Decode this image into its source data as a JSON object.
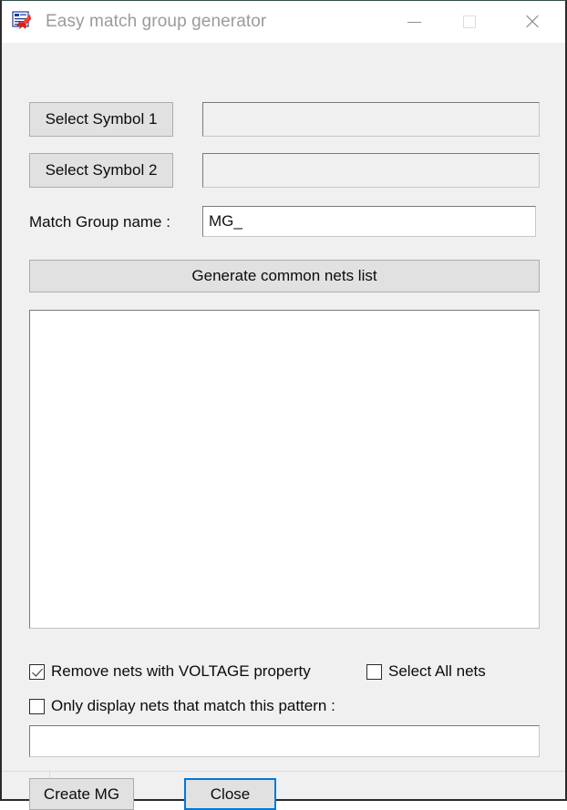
{
  "window": {
    "title": "Easy match group generator",
    "icon": "app-document-rocket-icon",
    "controls": {
      "minimize": "minimize-icon",
      "maximize": "maximize-icon",
      "close": "close-icon"
    },
    "title_color": "#9b9b9b",
    "accent_color": "#0078d7"
  },
  "form": {
    "select_symbol_1_label": "Select Symbol 1",
    "symbol_1_value": "",
    "symbol_1_placeholder": "",
    "select_symbol_2_label": "Select Symbol 2",
    "symbol_2_value": "",
    "symbol_2_placeholder": "",
    "match_group_name_label": "Match Group name :",
    "match_group_name_value": "MG_",
    "match_group_name_placeholder": "",
    "generate_label": "Generate common nets list",
    "nets_list_items": []
  },
  "options": {
    "remove_voltage_label": "Remove nets with VOLTAGE property",
    "remove_voltage_checked": true,
    "select_all_label": "Select All nets",
    "select_all_checked": false,
    "pattern_label": "Only display nets that match this pattern :",
    "pattern_checked": false,
    "pattern_value": "",
    "pattern_placeholder": ""
  },
  "actions": {
    "create_label": "Create MG",
    "close_label": "Close"
  },
  "statusbar": {
    "cell_1": "",
    "cell_2": ""
  }
}
